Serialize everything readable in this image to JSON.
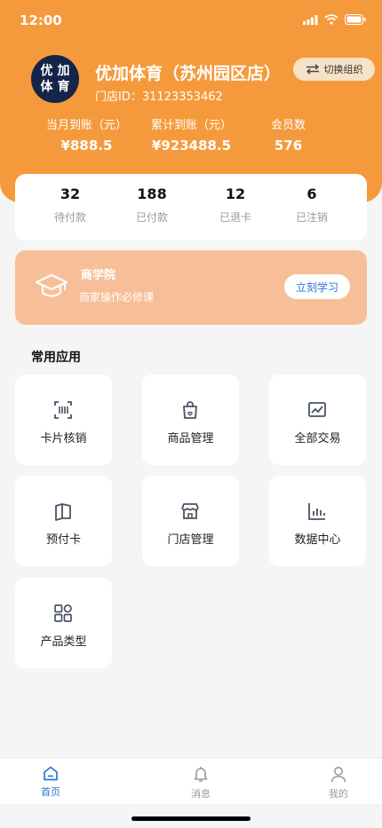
{
  "status_bar": {
    "time": "12:00"
  },
  "store": {
    "logo_chars": [
      "优",
      "加",
      "体",
      "育"
    ],
    "name": "优加体育（苏州园区店）",
    "id_text": "门店ID：31123353462",
    "switch_label": "切换组织"
  },
  "metrics": [
    {
      "label": "当月到账（元）",
      "value": "¥888.5"
    },
    {
      "label": "累计到账（元）",
      "value": "¥923488.5"
    },
    {
      "label": "会员数",
      "value": "576"
    }
  ],
  "stats": [
    {
      "num": "32",
      "label": "待付款"
    },
    {
      "num": "188",
      "label": "已付款"
    },
    {
      "num": "12",
      "label": "已退卡"
    },
    {
      "num": "6",
      "label": "已注销"
    }
  ],
  "banner": {
    "icon": "graduation-cap-icon",
    "title": "商学院",
    "subtitle": "商家操作必修课",
    "button": "立刻学习"
  },
  "apps_section_title": "常用应用",
  "apps": [
    {
      "label": "卡片核销",
      "icon": "scan-icon"
    },
    {
      "label": "商品管理",
      "icon": "shopping-bag-icon"
    },
    {
      "label": "全部交易",
      "icon": "trend-chart-icon"
    },
    {
      "label": "预付卡",
      "icon": "card-icon"
    },
    {
      "label": "门店管理",
      "icon": "store-icon"
    },
    {
      "label": "数据中心",
      "icon": "bar-chart-icon"
    },
    {
      "label": "产品类型",
      "icon": "grid-icon"
    }
  ],
  "tabbar": [
    {
      "label": "首页",
      "icon": "home-icon",
      "active": true
    },
    {
      "label": "消息",
      "icon": "bell-icon",
      "active": false
    },
    {
      "label": "我的",
      "icon": "user-icon",
      "active": false
    }
  ],
  "colors": {
    "header": "#f59a3c",
    "banner": "#f7bf97",
    "accent": "#2b74d8",
    "logo_bg": "#16244a"
  }
}
